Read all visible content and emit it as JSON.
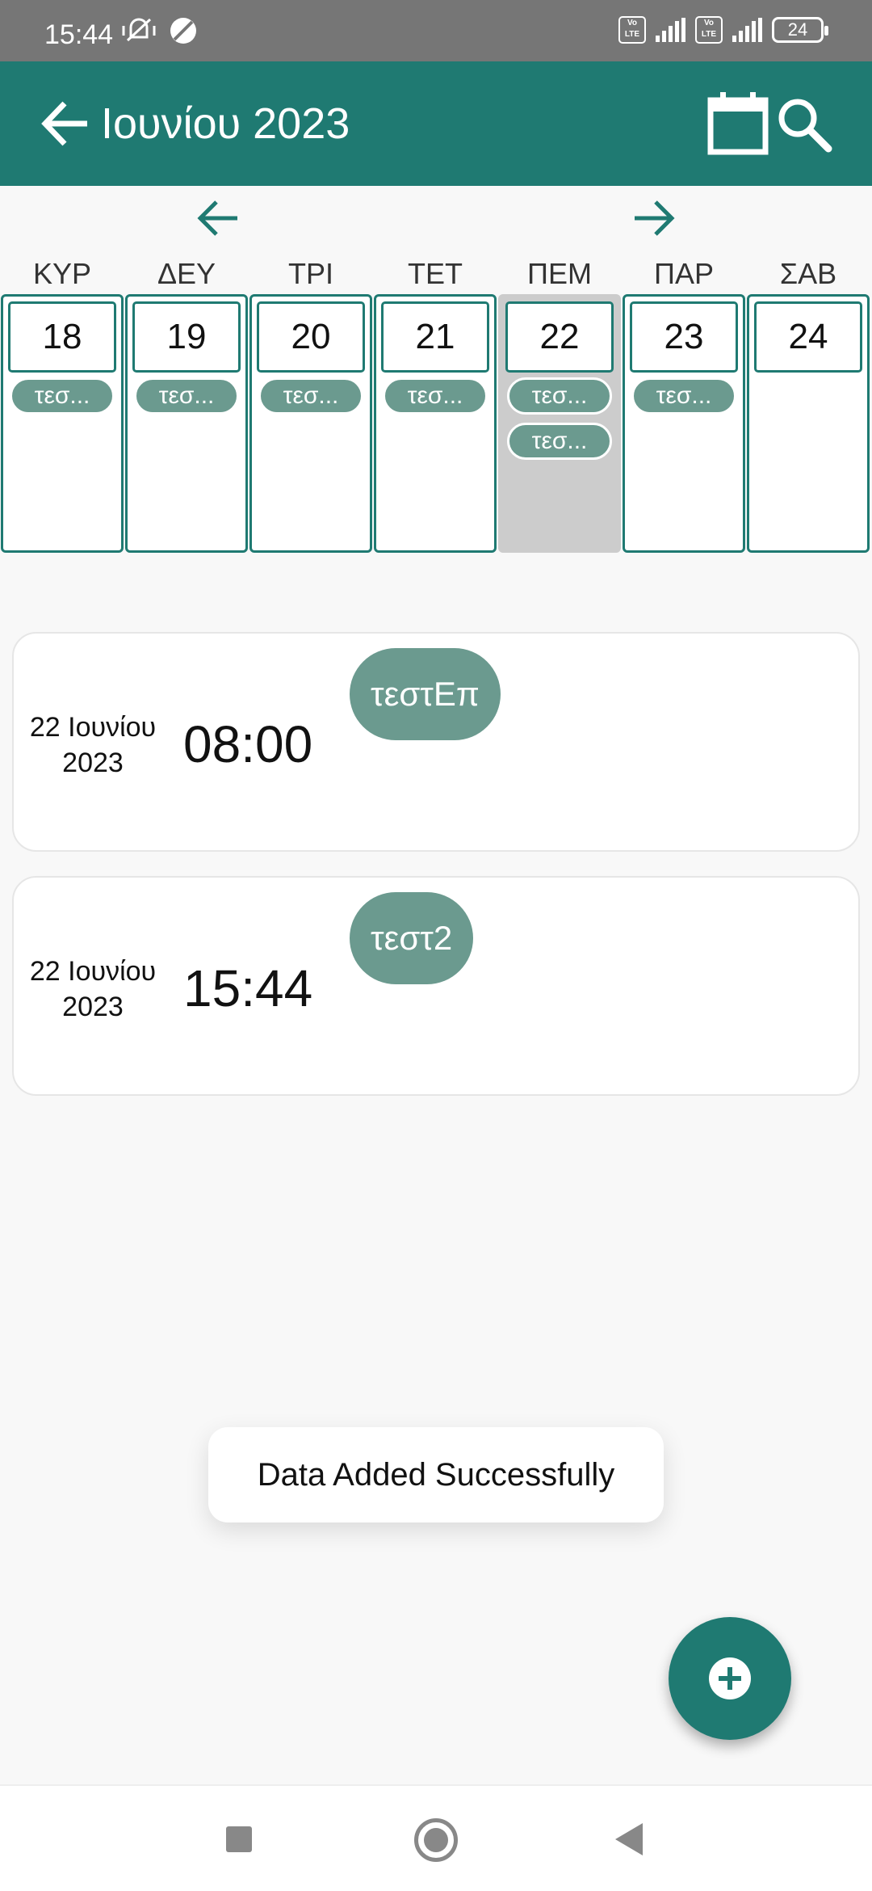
{
  "status_bar": {
    "time": "15:44",
    "battery": "24"
  },
  "app_bar": {
    "title": "Ιουνίου 2023",
    "icons": [
      "back-arrow-icon",
      "calendar-icon",
      "search-icon"
    ]
  },
  "week": {
    "days": [
      {
        "header": "ΚΥΡ",
        "number": "18",
        "chips": [
          "τεσ..."
        ]
      },
      {
        "header": "ΔΕΥ",
        "number": "19",
        "chips": [
          "τεσ..."
        ]
      },
      {
        "header": "ΤΡΙ",
        "number": "20",
        "chips": [
          "τεσ..."
        ]
      },
      {
        "header": "ΤΕΤ",
        "number": "21",
        "chips": [
          "τεσ..."
        ]
      },
      {
        "header": "ΠΕΜ",
        "number": "22",
        "chips": [
          "τεσ...",
          "τεσ..."
        ],
        "selected": true
      },
      {
        "header": "ΠΑΡ",
        "number": "23",
        "chips": [
          "τεσ..."
        ]
      },
      {
        "header": "ΣΑΒ",
        "number": "24",
        "chips": []
      }
    ]
  },
  "events": [
    {
      "date_line1": "22 Ιουνίου",
      "date_line2": "2023",
      "time": "08:00",
      "title": "τεστΕπ"
    },
    {
      "date_line1": "22 Ιουνίου",
      "date_line2": "2023",
      "time": "15:44",
      "title": "τεστ2"
    }
  ],
  "toast": "Data Added Successfully",
  "colors": {
    "primary": "#1f7a72",
    "chip": "#6b9a8f",
    "selected_day_bg": "#cccccc",
    "status_bar": "#767676"
  }
}
